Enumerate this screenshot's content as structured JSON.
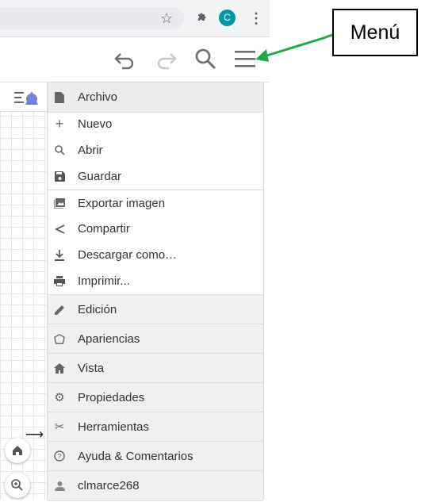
{
  "browser": {
    "avatar_letter": "C",
    "avatar_color": "#0097a7"
  },
  "menu": {
    "items": [
      {
        "label": "Archivo",
        "icon": "file-icon"
      },
      {
        "label": "Nuevo",
        "icon": "plus-icon"
      },
      {
        "label": "Abrir",
        "icon": "search-icon"
      },
      {
        "label": "Guardar",
        "icon": "save-icon"
      },
      {
        "label": "Exportar imagen",
        "icon": "image-icon"
      },
      {
        "label": "Compartir",
        "icon": "share-icon"
      },
      {
        "label": "Descargar como…",
        "icon": "download-icon"
      },
      {
        "label": "Imprimir...",
        "icon": "print-icon"
      },
      {
        "label": "Edición",
        "icon": "pencil-icon"
      },
      {
        "label": "Apariencias",
        "icon": "perspectives-icon"
      },
      {
        "label": "Vista",
        "icon": "home-icon"
      },
      {
        "label": "Propiedades",
        "icon": "gear-icon"
      },
      {
        "label": "Herramientas",
        "icon": "tools-icon"
      },
      {
        "label": "Ayuda & Comentarios",
        "icon": "help-icon"
      },
      {
        "label": "clmarce268",
        "icon": "user-icon"
      }
    ]
  },
  "annotation": {
    "callout_text": "Menú",
    "arrow_color": "#22a84a"
  }
}
